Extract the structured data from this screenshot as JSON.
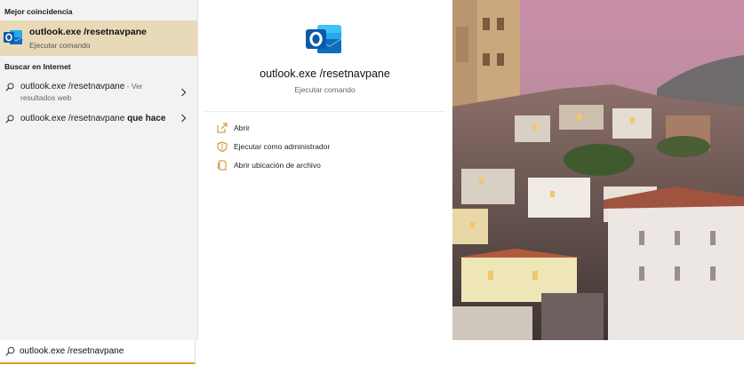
{
  "best_match": {
    "header": "Mejor coincidencia",
    "title": "outlook.exe /resetnavpane",
    "subtitle": "Ejecutar comando",
    "icon": "outlook-app-icon"
  },
  "web": {
    "header": "Buscar en Internet",
    "results": [
      {
        "query": "outlook.exe /resetnavpane",
        "suffix": " - Ver",
        "subline": "resultados web",
        "bold": "",
        "icon": "search-icon"
      },
      {
        "query": "outlook.exe /resetnavpane",
        "suffix": "",
        "subline": "",
        "bold": " que hace",
        "icon": "search-icon"
      }
    ]
  },
  "detail": {
    "title": "outlook.exe /resetnavpane",
    "subtitle": "Ejecutar comando",
    "actions": [
      {
        "label": "Abrir",
        "icon": "open-icon"
      },
      {
        "label": "Ejecutar como administrador",
        "icon": "admin-shield-icon"
      },
      {
        "label": "Abrir ubicación de archivo",
        "icon": "file-location-icon"
      }
    ]
  },
  "search": {
    "value": "outlook.exe /resetnavpane",
    "icon": "search-icon"
  },
  "colors": {
    "selected_bg": "#e8d9b8",
    "accent": "#d99d2a",
    "outlook_blue": "#0f6cbd"
  }
}
